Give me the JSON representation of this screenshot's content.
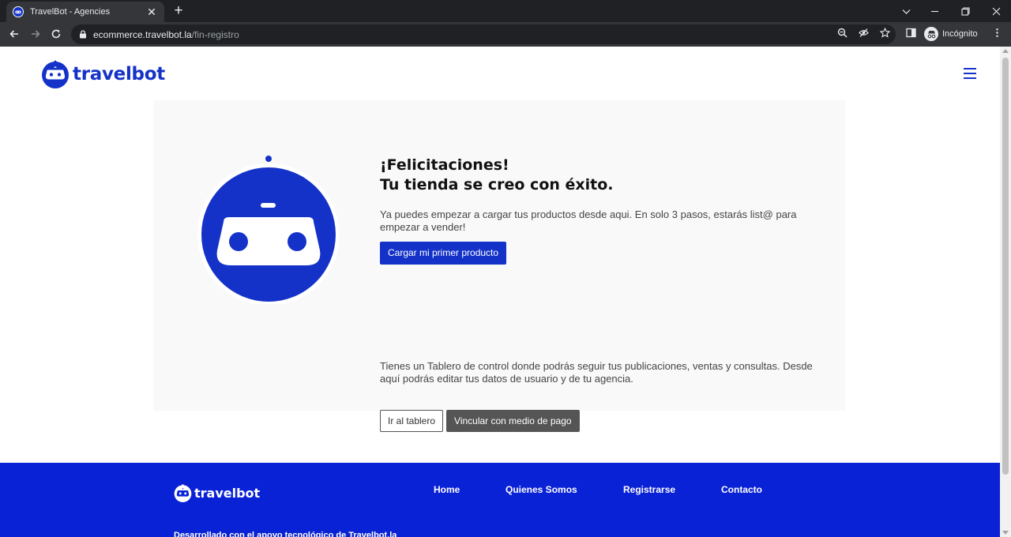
{
  "browser": {
    "tab_title": "TravelBot - Agencies",
    "url_host": "ecommerce.travelbot.la",
    "url_path": "/fin-registro",
    "profile_label": "Incógnito"
  },
  "header": {
    "logo_text": "travelbot",
    "menu_icon": "hamburger-menu-icon"
  },
  "main": {
    "title_line1": "¡Felicitaciones!",
    "title_line2": "Tu tienda se creo con éxito.",
    "intro": "Ya puedes empezar a cargar tus productos desde aqui. En solo 3 pasos, estarás list@ para empezar a vender!",
    "primary_button": "Cargar mi primer producto",
    "dashboard_text": "Tienes un Tablero de control donde podrás seguir tus publicaciones, ventas y consultas. Desde aquí podrás editar tus datos de usuario y de tu agencia.",
    "dashboard_button": "Ir al tablero",
    "payment_button": "Vincular con medio de pago"
  },
  "footer": {
    "logo_text": "travelbot",
    "nav": [
      "Home",
      "Quienes Somos",
      "Registrarse",
      "Contacto"
    ],
    "credit": "Desarrollado con el apoyo tecnológico de Travelbot.la"
  },
  "colors": {
    "brand_blue": "#1432c8",
    "footer_blue": "#0a22d6",
    "dark_button": "#555555"
  }
}
